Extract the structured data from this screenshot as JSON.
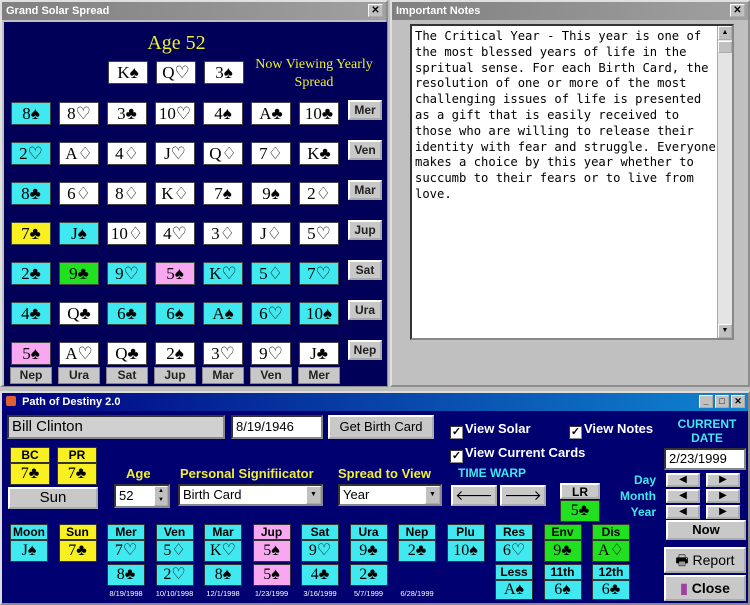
{
  "solar_window": {
    "title": "Grand Solar Spread",
    "age_title": "Age 52",
    "viewing_text": "Now Viewing Yearly Spread",
    "top_cards": [
      "K♠",
      "Q♡",
      "3♠"
    ],
    "rows": [
      {
        "planet": "Mer",
        "cards": [
          {
            "t": "8♠",
            "c": "cyan"
          },
          {
            "t": "8♡",
            "c": "white"
          },
          {
            "t": "3♣",
            "c": "white"
          },
          {
            "t": "10♡",
            "c": "white"
          },
          {
            "t": "4♠",
            "c": "white"
          },
          {
            "t": "A♣",
            "c": "white"
          },
          {
            "t": "10♣",
            "c": "white"
          }
        ]
      },
      {
        "planet": "Ven",
        "cards": [
          {
            "t": "2♡",
            "c": "cyan"
          },
          {
            "t": "A♢",
            "c": "white"
          },
          {
            "t": "4♢",
            "c": "white"
          },
          {
            "t": "J♡",
            "c": "white"
          },
          {
            "t": "Q♢",
            "c": "white"
          },
          {
            "t": "7♢",
            "c": "white"
          },
          {
            "t": "K♣",
            "c": "white"
          }
        ]
      },
      {
        "planet": "Mar",
        "cards": [
          {
            "t": "8♣",
            "c": "cyan"
          },
          {
            "t": "6♢",
            "c": "white"
          },
          {
            "t": "8♢",
            "c": "white"
          },
          {
            "t": "K♢",
            "c": "white"
          },
          {
            "t": "7♠",
            "c": "white"
          },
          {
            "t": "9♠",
            "c": "white"
          },
          {
            "t": "2♢",
            "c": "white"
          }
        ]
      },
      {
        "planet": "Jup",
        "cards": [
          {
            "t": "7♣",
            "c": "yellow"
          },
          {
            "t": "J♠",
            "c": "cyan"
          },
          {
            "t": "10♢",
            "c": "white"
          },
          {
            "t": "4♡",
            "c": "white"
          },
          {
            "t": "3♢",
            "c": "white"
          },
          {
            "t": "J♢",
            "c": "white"
          },
          {
            "t": "5♡",
            "c": "white"
          }
        ]
      },
      {
        "planet": "Sat",
        "cards": [
          {
            "t": "2♣",
            "c": "cyan"
          },
          {
            "t": "9♣",
            "c": "green"
          },
          {
            "t": "9♡",
            "c": "cyan"
          },
          {
            "t": "5♠",
            "c": "pink"
          },
          {
            "t": "K♡",
            "c": "cyan"
          },
          {
            "t": "5♢",
            "c": "cyan"
          },
          {
            "t": "7♡",
            "c": "cyan"
          }
        ]
      },
      {
        "planet": "Ura",
        "cards": [
          {
            "t": "4♣",
            "c": "cyan"
          },
          {
            "t": "Q♣",
            "c": "white"
          },
          {
            "t": "6♣",
            "c": "cyan"
          },
          {
            "t": "6♠",
            "c": "cyan"
          },
          {
            "t": "A♠",
            "c": "cyan"
          },
          {
            "t": "6♡",
            "c": "cyan"
          },
          {
            "t": "10♠",
            "c": "cyan"
          }
        ]
      },
      {
        "planet": "Nep",
        "cards": [
          {
            "t": "5♠",
            "c": "pink"
          },
          {
            "t": "A♡",
            "c": "white"
          },
          {
            "t": "Q♣",
            "c": "white"
          },
          {
            "t": "2♠",
            "c": "white"
          },
          {
            "t": "3♡",
            "c": "white"
          },
          {
            "t": "9♡",
            "c": "white"
          },
          {
            "t": "J♣",
            "c": "white"
          }
        ]
      }
    ],
    "bottom_labels": [
      "Nep",
      "Ura",
      "Sat",
      "Jup",
      "Mar",
      "Ven",
      "Mer"
    ]
  },
  "notes_window": {
    "title": "Important Notes",
    "text": "The Critical Year - This year is one of the most blessed years of life in the spritual sense. For each Birth Card, the resolution of one or more of the most challenging issues of life is presented as a gift that is easily received to those who are willing to release their identity with fear and struggle. Everyone makes a choice by this year whether to succumb to their fears or to live from love."
  },
  "main_window": {
    "title": "Path of Destiny 2.0",
    "name": "Bill Clinton",
    "birth_date": "8/19/1946",
    "get_birth_card": "Get Birth Card",
    "view_solar": "View Solar",
    "view_notes": "View Notes",
    "view_current": "View Current Cards",
    "current_date_label": "CURRENT DATE",
    "current_date": "2/23/1999",
    "bc_label": "BC",
    "bc_card": "7♣",
    "pr_label": "PR",
    "pr_card": "7♣",
    "sun_label": "Sun",
    "age_label": "Age",
    "age_value": "52",
    "sig_label": "Personal Signifiicator",
    "sig_value": "Birth Card",
    "spread_label": "Spread to View",
    "spread_value": "Year",
    "time_warp": "TIME WARP",
    "lr_label": "LR",
    "lr_card": "5♣",
    "day_label": "Day",
    "month_label": "Month",
    "year_label": "Year",
    "now_button": "Now",
    "report_button": "Report",
    "close_button": "Close",
    "period_labels": [
      {
        "l": "Moon",
        "card": "J♠",
        "cc": "cyan",
        "lc": "cyan",
        "card2": "",
        "date": ""
      },
      {
        "l": "Sun",
        "card": "7♣",
        "cc": "yellow",
        "lc": "yellow",
        "card2": "",
        "date": ""
      },
      {
        "l": "Mer",
        "card": "7♡",
        "cc": "cyan",
        "lc": "cyan",
        "card2": "8♣",
        "date": "8/19/1998"
      },
      {
        "l": "Ven",
        "card": "5♢",
        "cc": "cyan",
        "lc": "cyan",
        "card2": "2♡",
        "date": "10/10/1998"
      },
      {
        "l": "Mar",
        "card": "K♡",
        "cc": "cyan",
        "lc": "cyan",
        "card2": "8♠",
        "date": "12/1/1998"
      },
      {
        "l": "Jup",
        "card": "5♠",
        "cc": "pink",
        "lc": "pink",
        "card2": "5♠",
        "date": "1/23/1999"
      },
      {
        "l": "Sat",
        "card": "9♡",
        "cc": "cyan",
        "lc": "cyan",
        "card2": "4♣",
        "date": "3/16/1999"
      },
      {
        "l": "Ura",
        "card": "9♣",
        "cc": "cyan",
        "lc": "cyan",
        "card2": "2♣",
        "date": "5/7/1999"
      },
      {
        "l": "Nep",
        "card": "2♣",
        "cc": "cyan",
        "lc": "cyan",
        "card2": "",
        "date": "6/28/1999"
      },
      {
        "l": "Plu",
        "card": "10♠",
        "cc": "cyan",
        "lc": "cyan",
        "card2": "",
        "date": ""
      },
      {
        "l": "Res",
        "card": "6♡",
        "cc": "cyan",
        "lc": "cyan",
        "card2": "",
        "date": ""
      },
      {
        "l": "Env",
        "card": "9♣",
        "cc": "green",
        "lc": "green",
        "card2": "",
        "date": ""
      },
      {
        "l": "Dis",
        "card": "A♢",
        "cc": "green",
        "lc": "green",
        "card2": "",
        "date": ""
      }
    ],
    "lower_extra": [
      {
        "l": "Less",
        "card": "A♠"
      },
      {
        "l": "11th",
        "card": "6♠"
      },
      {
        "l": "12th",
        "card": "6♣"
      }
    ]
  },
  "colors": {
    "cyan": "#40e8f0",
    "yellow": "#f8f020",
    "pink": "#f8a8f0",
    "green": "#20e020",
    "white": "#ffffff"
  }
}
